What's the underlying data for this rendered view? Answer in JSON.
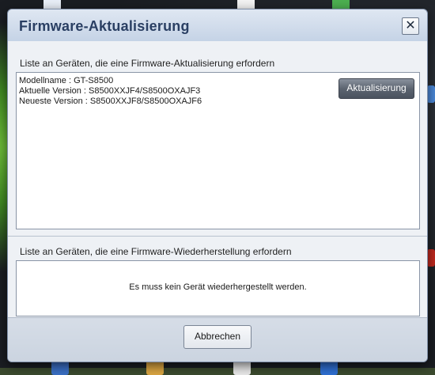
{
  "window": {
    "title": "Firmware-Aktualisierung",
    "close_symbol": "✕"
  },
  "update_section": {
    "label": "Liste an Geräten, die eine Firmware-Aktualisierung erfordern",
    "device": {
      "model_line": "Modellname : GT-S8500",
      "current_version_line": "Aktuelle Version : S8500XXJF4/S8500OXAJF3",
      "latest_version_line": "Neueste Version : S8500XXJF8/S8500OXAJF6"
    },
    "update_button_label": "Aktualisierung"
  },
  "restore_section": {
    "label": "Liste an Geräten, die eine Firmware-Wiederherstellung erfordern",
    "empty_message": "Es muss kein Gerät wiederhergestellt werden."
  },
  "footer": {
    "cancel_button_label": "Abbrechen"
  },
  "colors": {
    "title_text": "#2a3f63",
    "update_button": "#5c6470",
    "panel_background": "#ffffff"
  }
}
